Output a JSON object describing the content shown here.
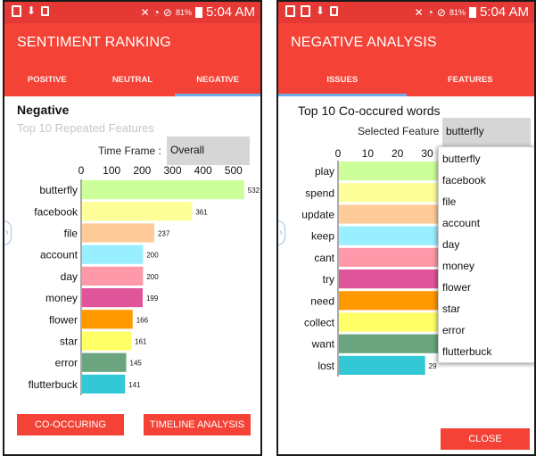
{
  "status_bar": {
    "battery": "81%",
    "time": "5:04 AM"
  },
  "left": {
    "title": "SENTIMENT RANKING",
    "tabs": [
      "POSITIVE",
      "NEUTRAL",
      "NEGATIVE"
    ],
    "active_tab": 2,
    "heading": "Negative",
    "subheading": "Top 10 Repeated Features",
    "timeframe_label": "Time Frame :",
    "timeframe_value": "Overall",
    "buttons": {
      "cooccurring": "CO-OCCURING",
      "timeline": "TIMELINE ANALYSIS"
    }
  },
  "right": {
    "title": "NEGATIVE ANALYSIS",
    "tabs": [
      "ISSUES",
      "FEATURES"
    ],
    "active_tab": 0,
    "heading": "Top 10 Co-occured words",
    "feature_label": "Selected Feature :",
    "feature_value": "butterfly",
    "dropdown_options": [
      "butterfly",
      "facebook",
      "file",
      "account",
      "day",
      "money",
      "flower",
      "star",
      "error",
      "flutterbuck"
    ],
    "close_button": "CLOSE"
  },
  "colors": {
    "statusbar": "#e53935",
    "appbar": "#f44336",
    "tab_indicator": "#64b5f6",
    "bar_palette": [
      "#ccff99",
      "#ffff99",
      "#ffcc99",
      "#99eeff",
      "#ff99aa",
      "#e0559a",
      "#ff9900",
      "#ffff66",
      "#6aa57f",
      "#33c8d6"
    ]
  },
  "icons": [
    "screenshot-icon",
    "download-icon",
    "bag-icon",
    "mute-icon",
    "wifi-icon",
    "no-sync-icon",
    "battery-icon",
    "image-icon"
  ],
  "chart_data": [
    {
      "type": "bar",
      "orientation": "horizontal",
      "categories": [
        "butterfly",
        "facebook",
        "file",
        "account",
        "day",
        "money",
        "flower",
        "star",
        "error",
        "flutterbuck"
      ],
      "values": [
        532,
        361,
        237,
        200,
        200,
        199,
        166,
        161,
        145,
        141
      ],
      "xticks": [
        0,
        100,
        200,
        300,
        400,
        500
      ],
      "xlim": [
        0,
        600
      ],
      "data_labels": true
    },
    {
      "type": "bar",
      "orientation": "horizontal",
      "categories": [
        "play",
        "spend",
        "update",
        "keep",
        "cant",
        "try",
        "need",
        "collect",
        "want",
        "lost"
      ],
      "values": [
        null,
        null,
        null,
        null,
        null,
        null,
        null,
        null,
        null,
        29
      ],
      "xticks": [
        0,
        10,
        20,
        30
      ],
      "xlim": [
        0,
        33
      ],
      "data_labels": true
    }
  ]
}
